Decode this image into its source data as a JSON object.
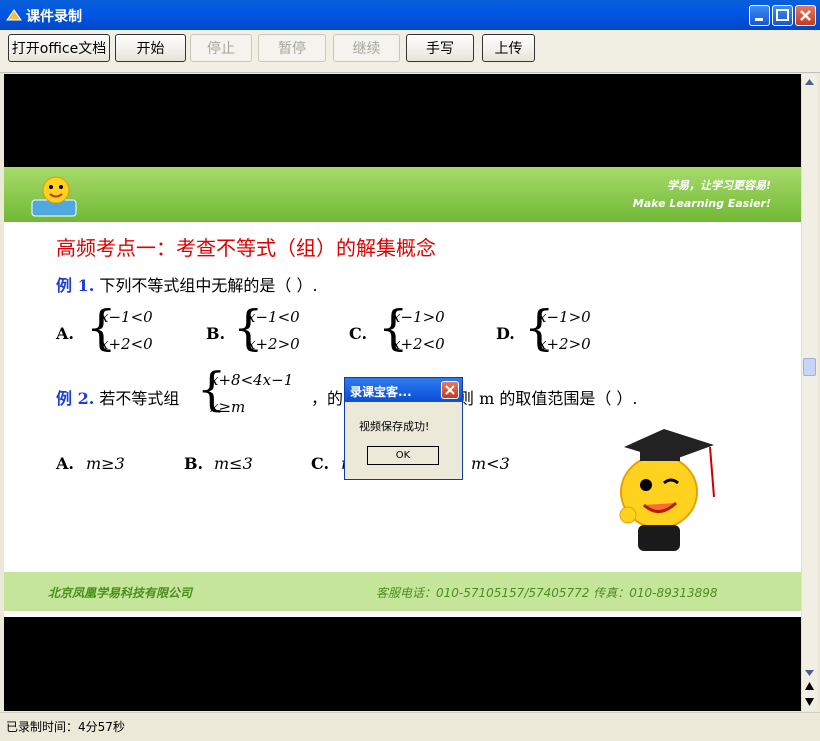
{
  "window": {
    "title": "课件录制"
  },
  "toolbar": [
    {
      "label": "打开office文档",
      "enabled": true
    },
    {
      "label": "开始",
      "enabled": true
    },
    {
      "label": "停止",
      "enabled": false
    },
    {
      "label": "暂停",
      "enabled": false
    },
    {
      "label": "继续",
      "enabled": false
    },
    {
      "label": "手写",
      "enabled": true
    },
    {
      "label": "上传",
      "enabled": true
    }
  ],
  "slide": {
    "banner_slogan_cn": "学易，让学习更容易!",
    "banner_slogan_en": "Make Learning Easier!",
    "heading": "高频考点一：考查不等式（组）的解集概念",
    "q1": {
      "label": "例 1.",
      "text": "下列不等式组中无解的是（      ）.",
      "options": [
        {
          "letter": "A.",
          "line1": "x−1<0",
          "line2": "x+2<0"
        },
        {
          "letter": "B.",
          "line1": "x−1<0",
          "line2": "x+2>0"
        },
        {
          "letter": "C.",
          "line1": "x−1>0",
          "line2": "x+2<0"
        },
        {
          "letter": "D.",
          "line1": "x−1>0",
          "line2": "x+2>0"
        }
      ]
    },
    "q2": {
      "label": "例 2.",
      "prefix": "若不等式组",
      "line1": "x+8<4x−1",
      "line2": "x≥m",
      "suffix_pre": "，的",
      "suffix_post": "则 m 的取值范围是（      ）.",
      "options": [
        {
          "letter": "A.",
          "text": "m≥3"
        },
        {
          "letter": "B.",
          "text": "m≤3"
        },
        {
          "letter": "C.",
          "text": "m"
        },
        {
          "letter": "",
          "text": "m<3"
        }
      ]
    },
    "footer_company": "北京凤凰学易科技有限公司",
    "footer_contact": "客服电话：010-57105157/57405772     传真：010-89313898"
  },
  "dialog": {
    "title": "录课宝客...",
    "message": "视频保存成功!",
    "ok_label": "OK"
  },
  "status": {
    "label": "已录制时间：4分57秒"
  }
}
